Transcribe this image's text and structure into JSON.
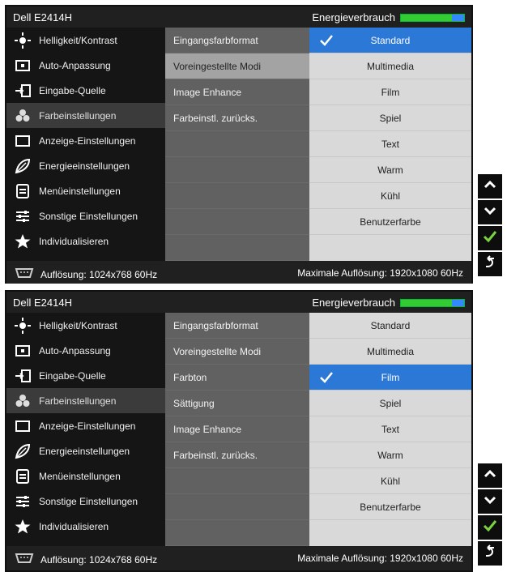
{
  "osd1": {
    "header": {
      "title": "Dell E2414H",
      "energy_label": "Energieverbrauch"
    },
    "sidebar": {
      "items": [
        {
          "label": "Helligkeit/Kontrast",
          "icon": "brightness-icon"
        },
        {
          "label": "Auto-Anpassung",
          "icon": "auto-adjust-icon"
        },
        {
          "label": "Eingabe-Quelle",
          "icon": "input-source-icon"
        },
        {
          "label": "Farbeinstellungen",
          "icon": "color-settings-icon"
        },
        {
          "label": "Anzeige-Einstellungen",
          "icon": "display-settings-icon"
        },
        {
          "label": "Energieeinstellungen",
          "icon": "energy-settings-icon"
        },
        {
          "label": "Menüeinstellungen",
          "icon": "menu-settings-icon"
        },
        {
          "label": "Sonstige Einstellungen",
          "icon": "other-settings-icon"
        },
        {
          "label": "Individualisieren",
          "icon": "personalize-icon"
        }
      ]
    },
    "middle": {
      "items": [
        "Eingangsfarbformat",
        "Voreingestellte Modi",
        "Image Enhance",
        "Farbeinstl. zurücks."
      ]
    },
    "right": {
      "items": [
        "Standard",
        "Multimedia",
        "Film",
        "Spiel",
        "Text",
        "Warm",
        "Kühl",
        "Benutzerfarbe"
      ]
    },
    "footer": {
      "left": "Auflösung: 1024x768 60Hz",
      "right": "Maximale Auflösung: 1920x1080 60Hz"
    }
  },
  "osd2": {
    "header": {
      "title": "Dell E2414H",
      "energy_label": "Energieverbrauch"
    },
    "sidebar": {
      "items": [
        {
          "label": "Helligkeit/Kontrast",
          "icon": "brightness-icon"
        },
        {
          "label": "Auto-Anpassung",
          "icon": "auto-adjust-icon"
        },
        {
          "label": "Eingabe-Quelle",
          "icon": "input-source-icon"
        },
        {
          "label": "Farbeinstellungen",
          "icon": "color-settings-icon"
        },
        {
          "label": "Anzeige-Einstellungen",
          "icon": "display-settings-icon"
        },
        {
          "label": "Energieeinstellungen",
          "icon": "energy-settings-icon"
        },
        {
          "label": "Menüeinstellungen",
          "icon": "menu-settings-icon"
        },
        {
          "label": "Sonstige Einstellungen",
          "icon": "other-settings-icon"
        },
        {
          "label": "Individualisieren",
          "icon": "personalize-icon"
        }
      ]
    },
    "middle": {
      "items": [
        "Eingangsfarbformat",
        "Voreingestellte Modi",
        "Farbton",
        "Sättigung",
        "Image Enhance",
        "Farbeinstl. zurücks."
      ]
    },
    "right": {
      "items": [
        "Standard",
        "Multimedia",
        "Film",
        "Spiel",
        "Text",
        "Warm",
        "Kühl",
        "Benutzerfarbe"
      ]
    },
    "footer": {
      "left": "Auflösung: 1024x768 60Hz",
      "right": "Maximale Auflösung: 1920x1080 60Hz"
    }
  }
}
